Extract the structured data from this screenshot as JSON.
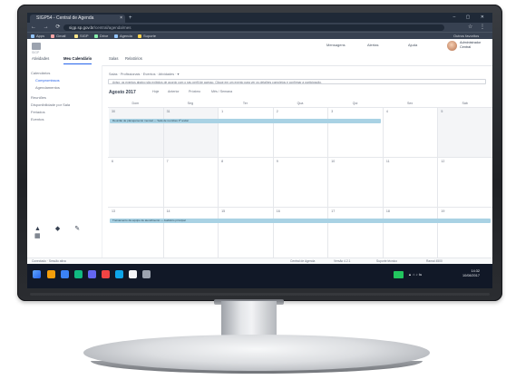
{
  "browser": {
    "tab_title": "SIGP54 - Central de Agenda",
    "tab_close": "×",
    "new_tab": "+",
    "window_controls": "–  ▢  ✕",
    "nav_buttons": "← → ⟳",
    "url_host": "sigp.sp.gov.br",
    "url_path": "/central/agenda/mes",
    "ext_buttons": "☆ ⋮",
    "bookmarks": [
      "Apps",
      "Gmail",
      "SIGP",
      "Drive",
      "Agenda",
      "Suporte"
    ],
    "other_bookmarks": "Outros favoritos"
  },
  "app": {
    "sub_brand": "SIGP",
    "header_links": [
      "Mensagens",
      "Alertas",
      "Ajuda"
    ],
    "user_name": "Administrador",
    "user_role": "Central",
    "nav_tabs": [
      "Atividades",
      "Meu Calendário",
      "Salas",
      "Relatórios"
    ],
    "active_tab": "Meu Calendário"
  },
  "sidebar": {
    "items": [
      "Calendários",
      "Compromissos",
      "Agendamentos",
      "Reuniões",
      "Disponibilidade por Sala",
      "Feriados",
      "Eventos"
    ],
    "selected_index": 1,
    "tools": "▲ ◆ ✎ ▦"
  },
  "calendar": {
    "filters": "Salas · Profissionais · Eventos · Atividades · ▾",
    "notice": "Aviso: os eventos abaixo são exibidos de acordo com o seu perfil de acesso. Clique em um evento para ver os detalhes completos e confirmar a participação.",
    "month_label": "Agosto 2017",
    "view_buttons": [
      "Hoje",
      "Anterior",
      "Próximo",
      "Mês / Semana"
    ],
    "weekdays": [
      "Dom",
      "Seg",
      "Ter",
      "Qua",
      "Qui",
      "Sex",
      "Sáb"
    ],
    "weeks": [
      [
        "30",
        "31",
        "1",
        "2",
        "3",
        "4",
        "5"
      ],
      [
        "6",
        "7",
        "8",
        "9",
        "10",
        "11",
        "12"
      ],
      [
        "13",
        "14",
        "15",
        "16",
        "17",
        "18",
        "19"
      ]
    ],
    "events": [
      {
        "title": "Reunião de planejamento mensal — Sala de reuniões 3º andar",
        "week": 0,
        "start": 0,
        "span": 5
      },
      {
        "title": "Treinamento da equipe de atendimento — Auditório principal",
        "week": 2,
        "start": 0,
        "span": 7
      }
    ]
  },
  "app_status": {
    "left": "Conectado · Sessão ativa",
    "items": [
      "Central de Agenda",
      "Versão 4.2.1",
      "Suporte técnico",
      "Ramal 4500"
    ]
  },
  "taskbar": {
    "icon_colors": [
      "#f59e0b",
      "#3b82f6",
      "#10b981",
      "#6366f1",
      "#ef4444",
      "#0ea5e9",
      "#f3f4f6",
      "#9ca3af"
    ],
    "tray": "▲ ⌂ ♪ ⇋",
    "time": "14:32",
    "date": "10/08/2017"
  }
}
